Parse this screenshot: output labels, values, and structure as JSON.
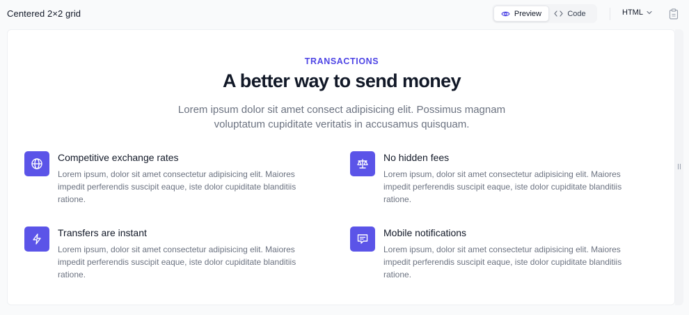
{
  "header": {
    "title": "Centered 2×2 grid",
    "preview_label": "Preview",
    "code_label": "Code",
    "language": "HTML"
  },
  "icons": {
    "preview": "eye-icon",
    "code": "code-brackets-icon",
    "language": "chevron-down-icon",
    "copy": "clipboard-icon"
  },
  "section": {
    "eyebrow": "TRANSACTIONS",
    "headline": "A better way to send money",
    "lead": "Lorem ipsum dolor sit amet consect adipisicing elit. Possimus magnam voluptatum cupiditate veritatis in accusamus quisquam."
  },
  "features": [
    {
      "title": "Competitive exchange rates",
      "description": "Lorem ipsum, dolor sit amet consectetur adipisicing elit. Maiores impedit perferendis suscipit eaque, iste dolor cupiditate blanditiis ratione.",
      "icon": "globe-icon"
    },
    {
      "title": "No hidden fees",
      "description": "Lorem ipsum, dolor sit amet consectetur adipisicing elit. Maiores impedit perferendis suscipit eaque, iste dolor cupiditate blanditiis ratione.",
      "icon": "scale-icon"
    },
    {
      "title": "Transfers are instant",
      "description": "Lorem ipsum, dolor sit amet consectetur adipisicing elit. Maiores impedit perferendis suscipit eaque, iste dolor cupiditate blanditiis ratione.",
      "icon": "lightning-bolt-icon"
    },
    {
      "title": "Mobile notifications",
      "description": "Lorem ipsum, dolor sit amet consectetur adipisicing elit. Maiores impedit perferendis suscipit eaque, iste dolor cupiditate blanditiis ratione.",
      "icon": "chat-bubble-icon"
    }
  ],
  "colors": {
    "accent": "#4f46e5",
    "icon_background": "#5b54e8",
    "heading": "#111827",
    "body_text": "#6b7280"
  }
}
